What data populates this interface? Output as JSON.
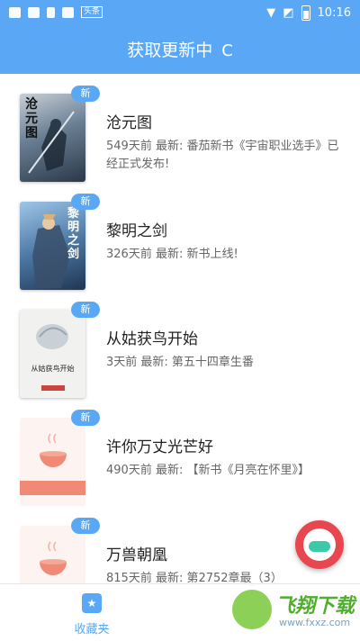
{
  "status_bar": {
    "time": "10:16",
    "tag": "头条"
  },
  "header": {
    "title": "获取更新中",
    "refresh_glyph": "C"
  },
  "books": [
    {
      "badge": "新",
      "title": "沧元图",
      "desc": "549天前 最新: 番茄新书《宇宙职业选手》已经正式发布!",
      "cover_text": "沧元图"
    },
    {
      "badge": "新",
      "title": "黎明之剑",
      "desc": "326天前 最新: 新书上线!",
      "cover_text": "黎明之剑"
    },
    {
      "badge": "新",
      "title": "从姑获鸟开始",
      "desc": "3天前 最新: 第五十四章生番",
      "cover_text": "从姑获鸟开始"
    },
    {
      "badge": "新",
      "title": "许你万丈光芒好",
      "desc": "490天前 最新: 【新书《月亮在怀里》】",
      "cover_text": ""
    },
    {
      "badge": "新",
      "title": "万兽朝凰",
      "desc": "815天前 最新: 第2752章最（3）",
      "cover_text": ""
    }
  ],
  "bottom_nav": {
    "favorites_label": "收藏夹"
  },
  "watermark": {
    "brand": "飞翔下载",
    "url": "www.fxxz.com"
  },
  "colors": {
    "primary": "#5aa8f5",
    "float_button": "#e9474f"
  }
}
